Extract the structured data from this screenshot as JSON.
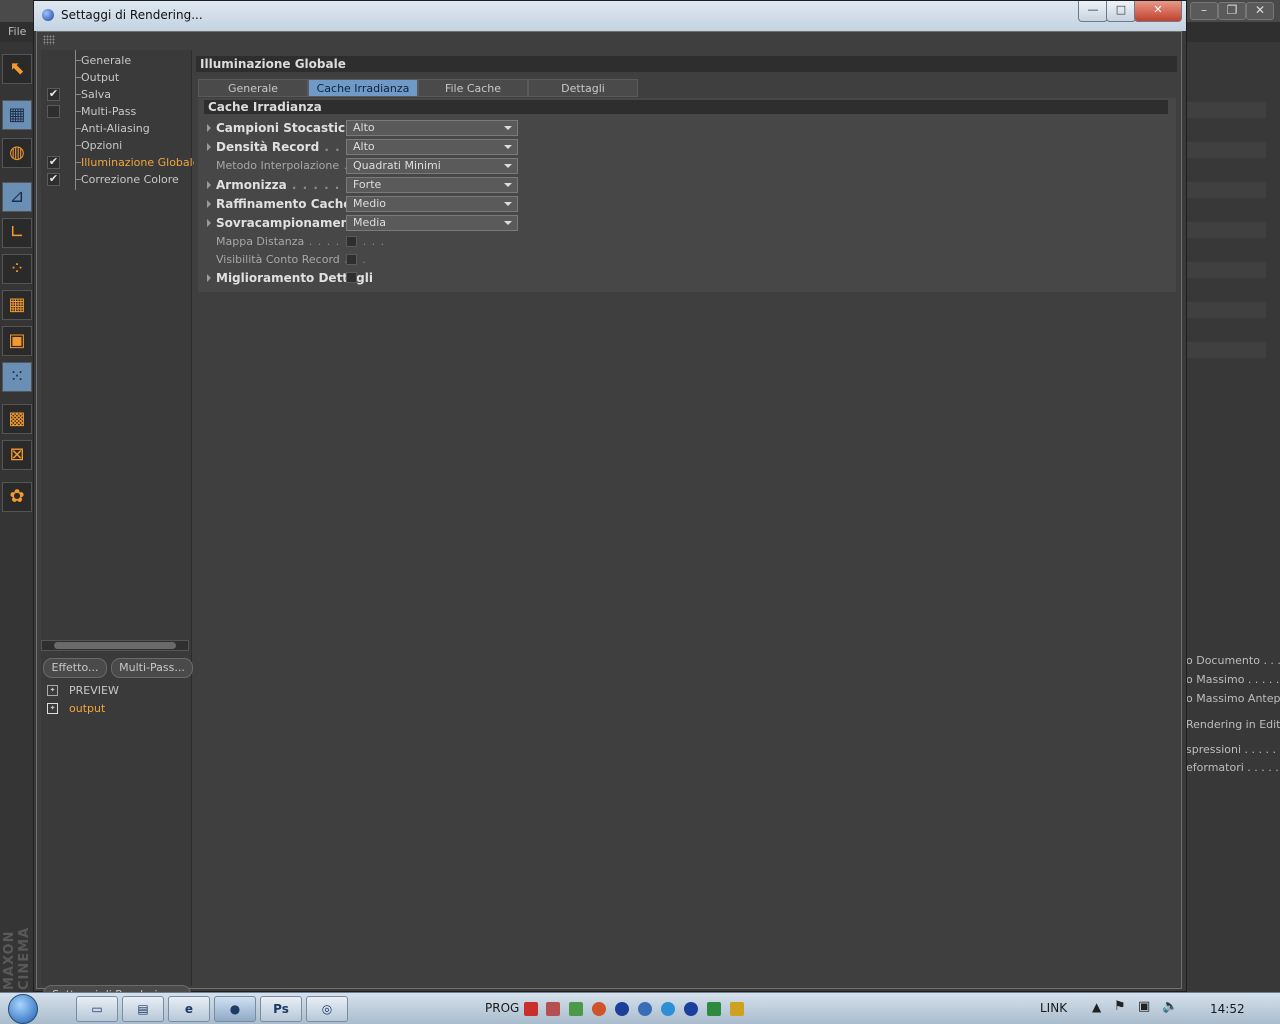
{
  "background_app": {
    "menu_file": "File",
    "right_panel_texts": [
      "o Documento . . .",
      "o Massimo . . . . .",
      "o Massimo Anteprir",
      "Rendering in Editor",
      "spressioni . . . . . .",
      "eformatori . . . . . ."
    ]
  },
  "dialog": {
    "title": "Settaggi di Rendering...",
    "window_buttons": {
      "minimize": "—",
      "maximize": "□",
      "close": "✕"
    }
  },
  "tree": {
    "items": [
      {
        "label": "Generale",
        "checkbox": null,
        "active": false
      },
      {
        "label": "Output",
        "checkbox": null,
        "active": false
      },
      {
        "label": "Salva",
        "checkbox": "checked",
        "active": false
      },
      {
        "label": "Multi-Pass",
        "checkbox": "unchecked",
        "active": false
      },
      {
        "label": "Anti-Aliasing",
        "checkbox": null,
        "active": false
      },
      {
        "label": "Opzioni",
        "checkbox": null,
        "active": false
      },
      {
        "label": "Illuminazione Globale",
        "checkbox": "checked",
        "active": true
      },
      {
        "label": "Correzione Colore",
        "checkbox": "checked",
        "active": false
      }
    ]
  },
  "bottom_buttons": {
    "effetto": "Effetto...",
    "multipass": "Multi-Pass..."
  },
  "presets": [
    {
      "label": "PREVIEW",
      "active": false
    },
    {
      "label": "output",
      "active": true
    }
  ],
  "render_settings_button": "Settaggi di Rendering...",
  "main": {
    "section_title": "Illuminazione Globale",
    "tabs": [
      {
        "label": "Generale",
        "active": false
      },
      {
        "label": "Cache Irradianza",
        "active": true
      },
      {
        "label": "File Cache Irradianza",
        "active": false
      },
      {
        "label": "Dettagli",
        "active": false
      }
    ],
    "group_title": "Cache Irradianza",
    "params": [
      {
        "label": "Campioni Stocastici",
        "dots": " . .",
        "type": "select",
        "value": "Alto",
        "bold": true,
        "arrow": true
      },
      {
        "label": "Densità Record",
        "dots": " . . . . . .",
        "type": "select",
        "value": "Alto",
        "bold": true,
        "arrow": true
      },
      {
        "label": "Metodo Interpolazione",
        "dots": " . . .",
        "type": "select",
        "value": "Quadrati Minimi",
        "bold": false,
        "arrow": false
      },
      {
        "label": "Armonizza",
        "dots": " . . . . . . . . . . . .",
        "type": "select",
        "value": "Forte",
        "bold": true,
        "arrow": true
      },
      {
        "label": "Raffinamento Cache",
        "dots": " .",
        "type": "select",
        "value": "Medio",
        "bold": true,
        "arrow": true
      },
      {
        "label": "Sovracampionamento",
        "dots": "",
        "type": "select",
        "value": "Media",
        "bold": true,
        "arrow": true
      },
      {
        "label": "Mappa Distanza",
        "dots": " . . . . . . . . .",
        "type": "checkbox",
        "value": "",
        "bold": false,
        "arrow": false
      },
      {
        "label": "Visibilità Conto Record",
        "dots": " . . .",
        "type": "checkbox",
        "value": "",
        "bold": false,
        "arrow": false
      },
      {
        "label": "Miglioramento Dettagli",
        "dots": "",
        "type": "checkbox",
        "value": "",
        "bold": true,
        "arrow": true
      }
    ]
  },
  "taskbar": {
    "prog_label": "PROG",
    "link_label": "LINK",
    "clock": "14:52"
  }
}
